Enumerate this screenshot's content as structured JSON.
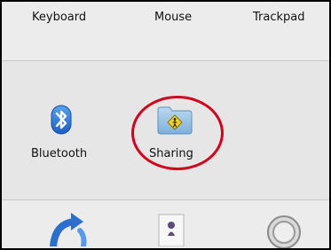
{
  "top_row": {
    "items": [
      {
        "label": "Keyboard"
      },
      {
        "label": "Mouse"
      },
      {
        "label": "Trackpad"
      }
    ]
  },
  "middle_row": {
    "items": [
      {
        "label": "Bluetooth",
        "icon": "bluetooth-icon"
      },
      {
        "label": "Sharing",
        "icon": "sharing-folder-icon",
        "highlighted": true
      }
    ]
  },
  "bottom_row": {
    "icons": [
      "sync-icon",
      "person-icon",
      "gauge-icon"
    ]
  },
  "colors": {
    "highlight": "#d0021b",
    "bluetooth_blue": "#2b7be0",
    "folder_blue": "#9ec7e8",
    "warning_yellow": "#f5d327"
  }
}
